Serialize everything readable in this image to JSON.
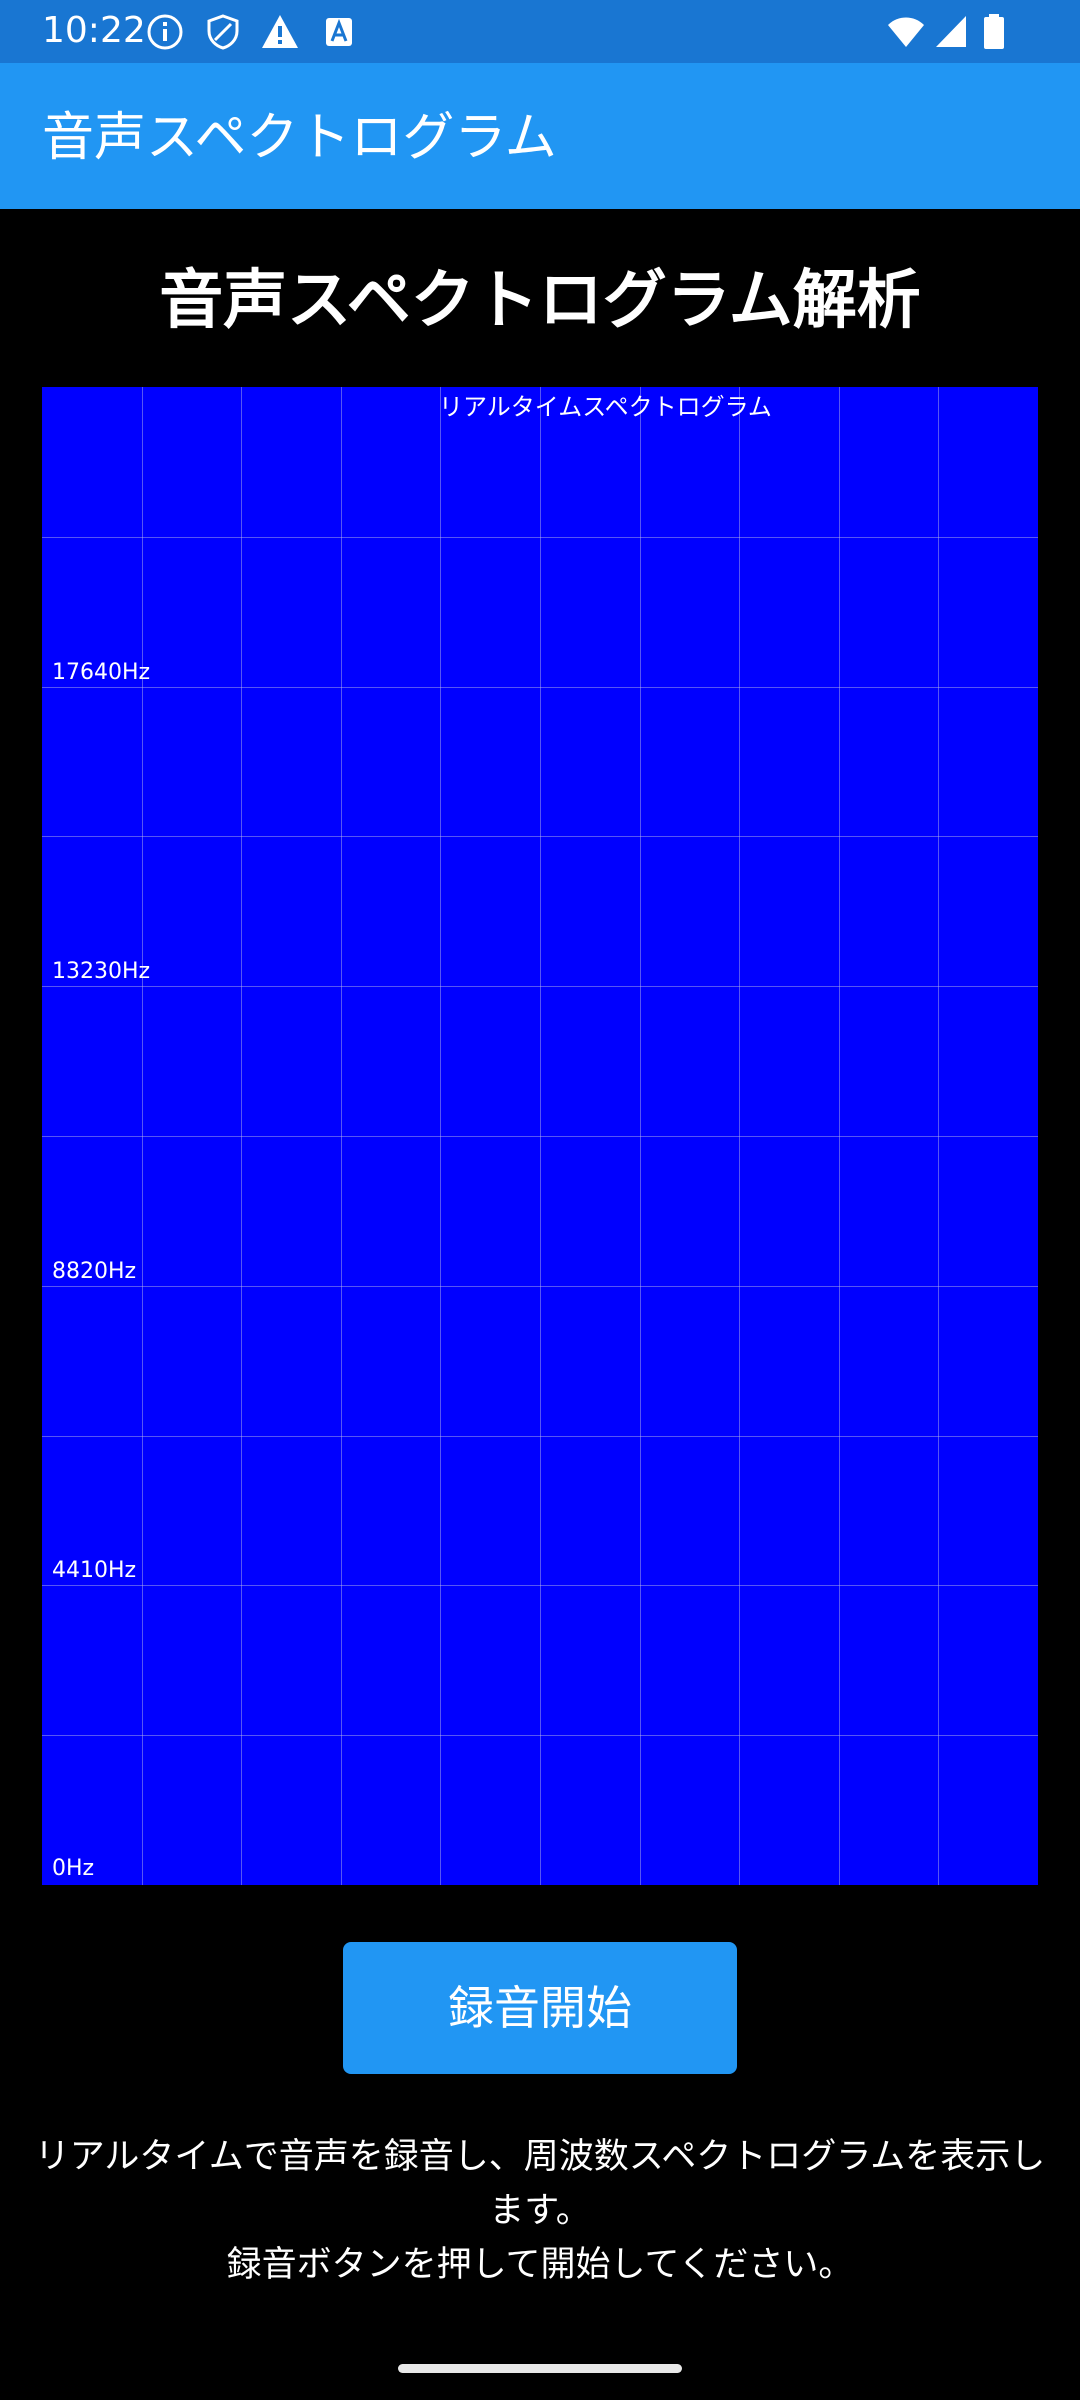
{
  "status_bar": {
    "time": "10:22",
    "left_icons": [
      "info-icon",
      "shield-icon",
      "warning-icon",
      "text-accessibility-icon"
    ],
    "right_icons": [
      "wifi-icon",
      "cellular-signal-icon",
      "battery-icon"
    ]
  },
  "app_bar": {
    "title": "音声スペクトログラム"
  },
  "main": {
    "heading": "音声スペクトログラム解析",
    "record_button_label": "録音開始",
    "instructions_line1": "リアルタイムで音声を録音し、周波数スペクトログラムを表示します。",
    "instructions_line2": "録音ボタンを押して開始してください。"
  },
  "chart_data": {
    "type": "heatmap",
    "title": "リアルタイムスペクトログラム",
    "y_tick_labels": [
      "17640Hz",
      "13230Hz",
      "8820Hz",
      "4410Hz",
      "0Hz"
    ],
    "y_ticks": [
      17640,
      13230,
      8820,
      4410,
      0
    ],
    "ylim": [
      0,
      22050
    ],
    "grid": true,
    "grid_columns": 10,
    "grid_rows": 10,
    "background_color": "#0000FF",
    "values": []
  },
  "colors": {
    "status_bar": "#1976D2",
    "app_bar": "#2196F3",
    "button": "#2196F3",
    "background": "#000000",
    "spectrogram_fill": "#0000FF"
  }
}
